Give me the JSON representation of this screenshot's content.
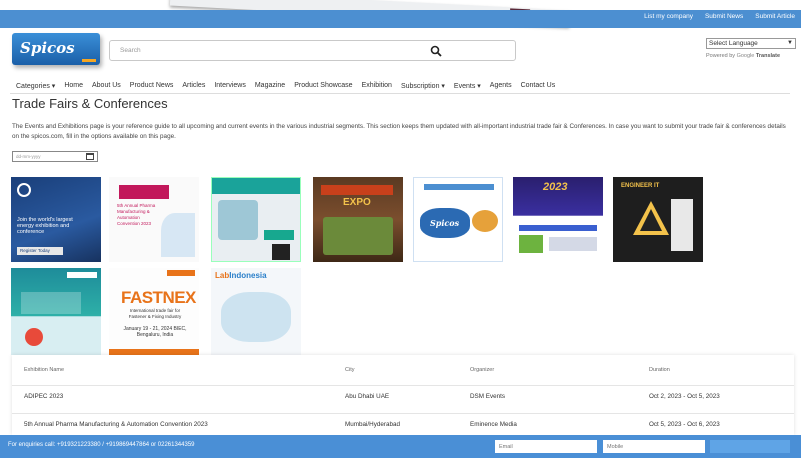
{
  "topbar": {
    "links": [
      "List my company",
      "Submit News",
      "Submit Article"
    ]
  },
  "header": {
    "logo_text": "Spicos",
    "search_placeholder": "Search",
    "language_select": "Select Language",
    "powered_by": "Powered by",
    "translate_label": "Translate"
  },
  "nav": {
    "items": [
      "Categories ▾",
      "Home",
      "About Us",
      "Product News",
      "Articles",
      "Interviews",
      "Magazine",
      "Product Showcase",
      "Exhibition",
      "Subscription ▾",
      "Events ▾",
      "Agents",
      "Contact Us"
    ]
  },
  "main": {
    "title": "Trade Fairs & Conferences",
    "description": "The Events and Exhibitions page is your reference guide to all upcoming and current events in the various industrial segments. This section keeps them updated with all-important industrial trade fair & Conferences. In case you want to submit your trade fair & conferences details on the spicos.com, fill in the options available on this page.",
    "date_placeholder": "dd-mm-yyyy"
  },
  "posters": {
    "p1_text": "Join the world's largest energy exhibition and conference",
    "p1_cta": "Register Today",
    "p2_text": "5th Annual Pharma Manufacturing & Automation Convention 2023",
    "p4_text": "EXPO",
    "p5_text": "Spicos",
    "p6_text": "2023",
    "p7_text": "ENGINEER IT",
    "p9_title": "FASTNEX",
    "p9_sub": "International trade fair for Fastener & Fixing Industry",
    "p9_date": "January 19 - 21, 2024 BIEC, Bengaluru, India",
    "p10_title_a": "Lab",
    "p10_title_b": "Indonesia"
  },
  "table": {
    "headers": [
      "Exhibition Name",
      "City",
      "Organizer",
      "Duration"
    ],
    "rows": [
      {
        "name": "ADIPEC 2023",
        "city": "Abu Dhabi UAE",
        "organizer": "DSM Events",
        "duration": "Oct 2, 2023 - Oct 5, 2023"
      },
      {
        "name": "5th Annual Pharma Manufacturing & Automation Convention 2023",
        "city": "Mumbai/Hyderabad",
        "organizer": "Eminence Media",
        "duration": "Oct 5, 2023 - Oct 6, 2023"
      }
    ]
  },
  "footer": {
    "enquiry": "For enquiries call: +919321223380 / +919869447864 or 02261344359",
    "email_placeholder": "Email",
    "mobile_placeholder": "Mobile"
  },
  "colors": {
    "brand_blue": "#4c8fd1",
    "accent_orange": "#e8731a"
  }
}
